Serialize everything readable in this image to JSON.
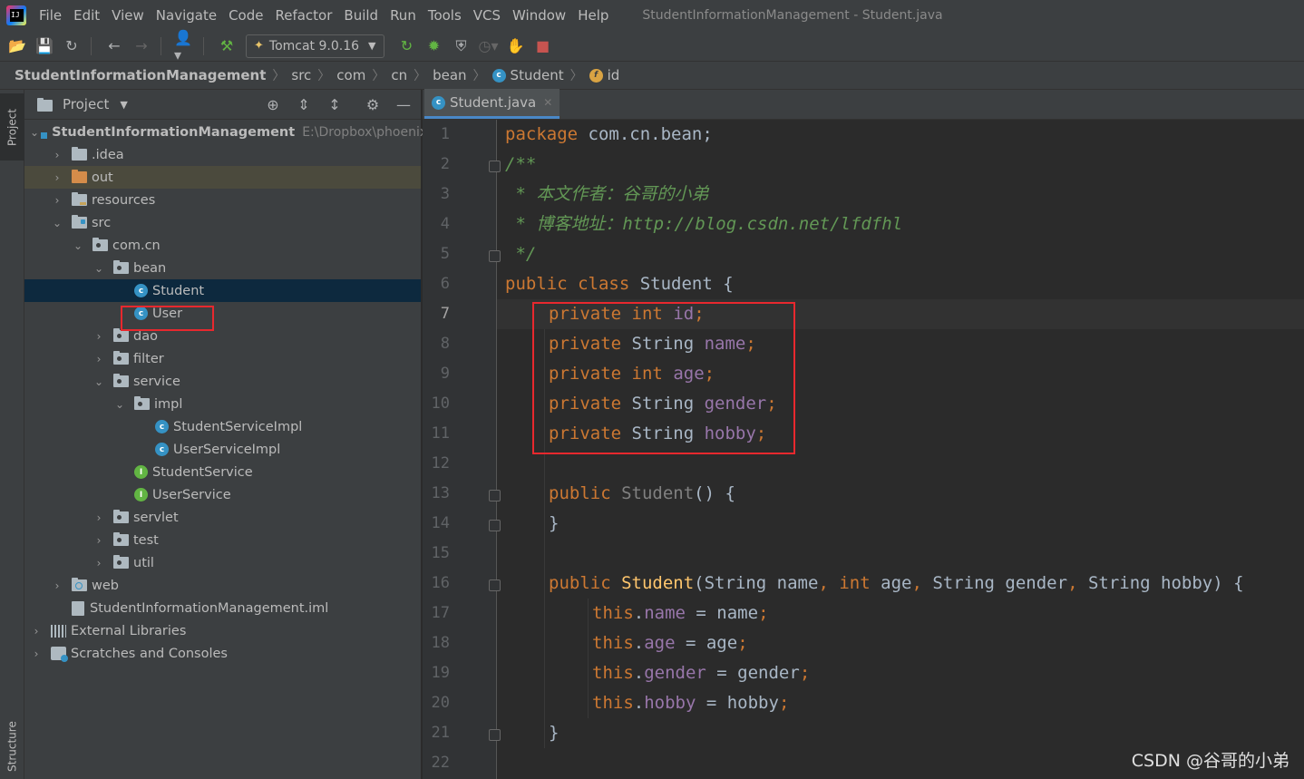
{
  "app": {
    "menu": [
      "File",
      "Edit",
      "View",
      "Navigate",
      "Code",
      "Refactor",
      "Build",
      "Run",
      "Tools",
      "VCS",
      "Window",
      "Help"
    ],
    "window_title": "StudentInformationManagement - Student.java"
  },
  "toolbar": {
    "run_config": "Tomcat 9.0.16"
  },
  "breadcrumb": [
    "StudentInformationManagement",
    "src",
    "com",
    "cn",
    "bean",
    "Student",
    "id"
  ],
  "strip": {
    "project": "Project",
    "structure": "Structure"
  },
  "project_panel": {
    "title": "Project",
    "root_name": "StudentInformationManagement",
    "root_path": "E:\\Dropbox\\phoenix\\",
    "items": [
      ".idea",
      "out",
      "resources",
      "src",
      "com.cn",
      "bean",
      "Student",
      "User",
      "dao",
      "filter",
      "service",
      "impl",
      "StudentServiceImpl",
      "UserServiceImpl",
      "StudentService",
      "UserService",
      "servlet",
      "test",
      "util",
      "web",
      "StudentInformationManagement.iml",
      "External Libraries",
      "Scratches and Consoles"
    ]
  },
  "editor": {
    "tab": "Student.java",
    "line_numbers": [
      "1",
      "2",
      "3",
      "4",
      "5",
      "6",
      "7",
      "8",
      "9",
      "10",
      "11",
      "12",
      "13",
      "14",
      "15",
      "16",
      "17",
      "18",
      "19",
      "20",
      "21",
      "22"
    ],
    "code": {
      "l1_kw": "package",
      "l1_rest": " com.cn.bean;",
      "l2": "/**",
      "l3": " * 本文作者：谷哥的小弟",
      "l4": " * 博客地址：http://blog.csdn.net/lfdfhl",
      "l5": " */",
      "l6_kw": "public class",
      "l6_rest": " Student {",
      "private": "private",
      "int": "int",
      "type_string": " String ",
      "semi": ";",
      "f_id": "id",
      "f_name": "name",
      "f_age": "age",
      "f_gender": "gender",
      "f_hobby": "hobby",
      "public": "public",
      "ctor_name": "Student",
      "l13_rest": "() {",
      "close_brace": "}",
      "l16_params_a": "(String name",
      "comma": ",",
      "l16_params_b": " age",
      "l16_params_c": " String gender",
      "l16_params_d": " String hobby) {",
      "this": "this",
      "dot": ".",
      "assign_name": " = name",
      "assign_age": " = age",
      "assign_gender": " = gender",
      "assign_hobby": " = hobby"
    }
  },
  "watermark": "CSDN @谷哥的小弟",
  "colors": {
    "keyword": "#cc7832",
    "comment": "#629755",
    "field": "#9876aa",
    "function": "#ffc66d",
    "highlight_box": "#e8282e"
  }
}
